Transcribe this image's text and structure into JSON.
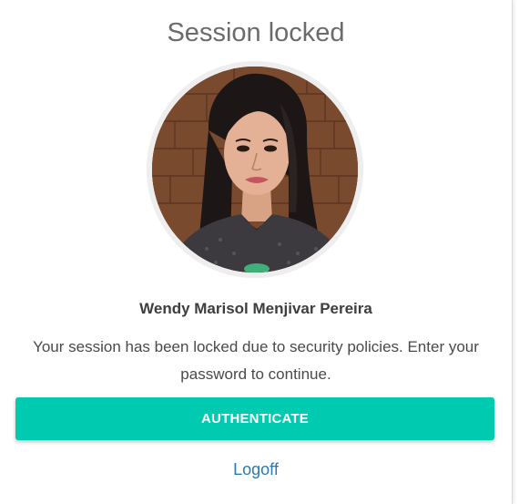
{
  "dialog": {
    "title": "Session locked",
    "user_name": "Wendy Marisol Menjivar Pereira",
    "message": "Your session has been locked due to security policies. Enter your password to continue.",
    "authenticate_label": "AUTHENTICATE",
    "logoff_label": "Logoff"
  },
  "colors": {
    "accent": "#00cbb0",
    "link": "#2a7ab8",
    "title": "#6b6b6b"
  },
  "avatar": {
    "icon": "user-photo"
  }
}
